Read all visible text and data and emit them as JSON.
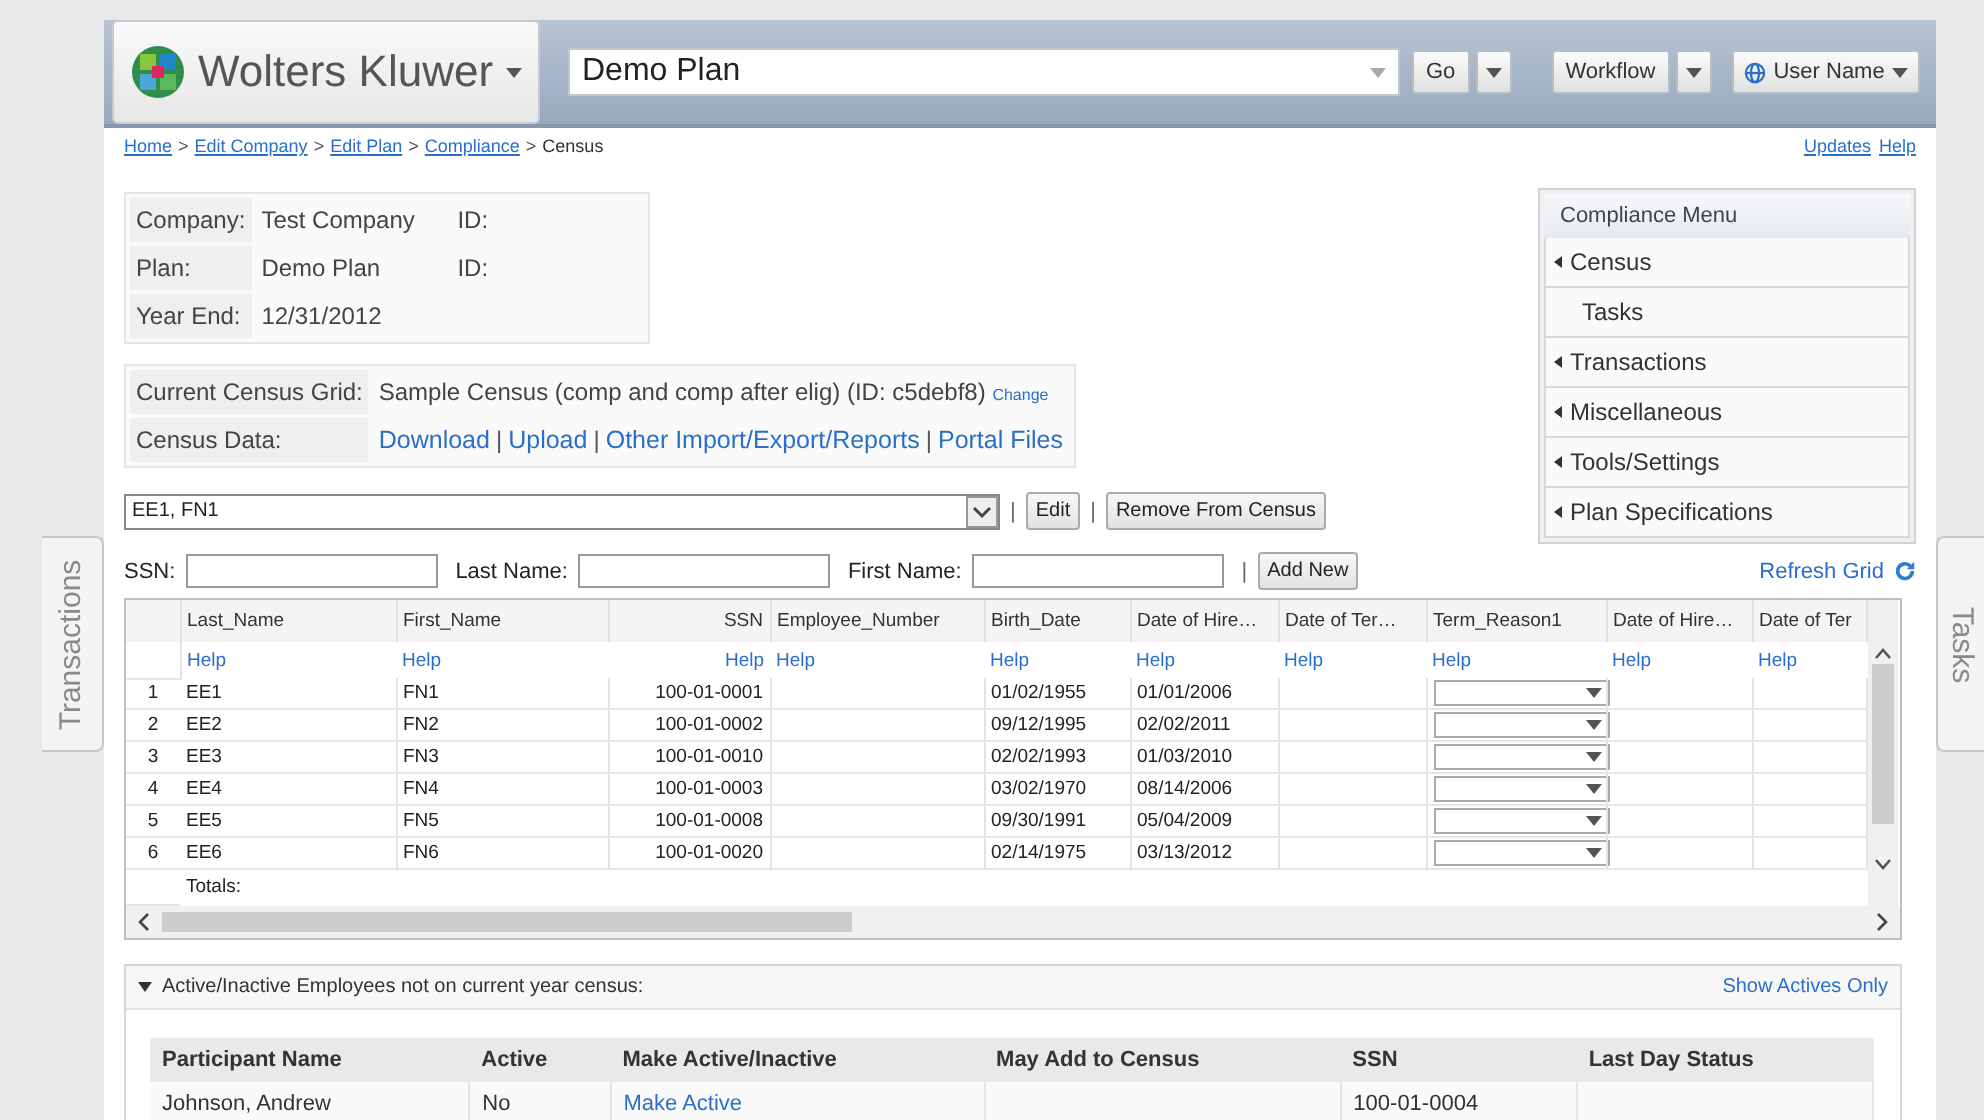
{
  "header": {
    "brand": "Wolters Kluwer",
    "search_value": "Demo Plan",
    "go": "Go",
    "workflow": "Workflow",
    "user": "User Name"
  },
  "breadcrumb": {
    "links": [
      "Home",
      "Edit Company",
      "Edit Plan",
      "Compliance"
    ],
    "separator": ">",
    "current": "Census",
    "right_links": [
      "Updates",
      "Help"
    ]
  },
  "info": [
    {
      "label": "Company:",
      "value": "Test Company",
      "id_label": "ID:"
    },
    {
      "label": "Plan:",
      "value": "Demo Plan",
      "id_label": "ID:"
    },
    {
      "label": "Year End:",
      "value": "12/31/2012"
    }
  ],
  "census": {
    "grid_label": "Current Census Grid:",
    "grid_value": "Sample Census (comp and comp after elig) (ID: c5debf8)",
    "change": "Change",
    "data_label": "Census Data:",
    "separator": "|",
    "data_links": [
      "Download",
      "Upload",
      "Other Import/Export/Reports",
      "Portal Files"
    ]
  },
  "compliance_menu": {
    "title": "Compliance Menu",
    "items": [
      {
        "label": "Census",
        "collapsible": true
      },
      {
        "label": "Tasks",
        "collapsible": false
      },
      {
        "label": "Transactions",
        "collapsible": true
      },
      {
        "label": "Miscellaneous",
        "collapsible": true
      },
      {
        "label": "Tools/Settings",
        "collapsible": true
      },
      {
        "label": "Plan Specifications",
        "collapsible": true
      }
    ]
  },
  "employee_select": {
    "value": "EE1, FN1",
    "separator": "|",
    "edit": "Edit",
    "remove": "Remove From Census"
  },
  "filters": {
    "fields": [
      "SSN:",
      "Last Name:",
      "First Name:"
    ],
    "separator": "|",
    "add_new": "Add New",
    "refresh": "Refresh Grid"
  },
  "grid": {
    "columns": [
      {
        "label": "Last_Name",
        "kind": "text",
        "help": "Help"
      },
      {
        "label": "First_Name",
        "kind": "text",
        "help": "Help"
      },
      {
        "label": "SSN",
        "kind": "number",
        "help": "Help"
      },
      {
        "label": "Employee_Number",
        "kind": "text",
        "help": "Help"
      },
      {
        "label": "Birth_Date",
        "kind": "text",
        "help": "Help"
      },
      {
        "label": "Date of Hire…",
        "kind": "text",
        "help": "Help"
      },
      {
        "label": "Date of Ter…",
        "kind": "text",
        "help": "Help"
      },
      {
        "label": "Term_Reason1",
        "kind": "select",
        "help": "Help"
      },
      {
        "label": "Date of Hire…",
        "kind": "text",
        "help": "Help"
      },
      {
        "label": "Date of Ter",
        "kind": "text",
        "help": "Help"
      }
    ],
    "rows": [
      {
        "num": "1",
        "cells": [
          "EE1",
          "FN1",
          "100-01-0001",
          "",
          "01/02/1955",
          "01/01/2006",
          "",
          "",
          "",
          ""
        ]
      },
      {
        "num": "2",
        "cells": [
          "EE2",
          "FN2",
          "100-01-0002",
          "",
          "09/12/1995",
          "02/02/2011",
          "",
          "",
          "",
          ""
        ]
      },
      {
        "num": "3",
        "cells": [
          "EE3",
          "FN3",
          "100-01-0010",
          "",
          "02/02/1993",
          "01/03/2010",
          "",
          "",
          "",
          ""
        ]
      },
      {
        "num": "4",
        "cells": [
          "EE4",
          "FN4",
          "100-01-0003",
          "",
          "03/02/1970",
          "08/14/2006",
          "",
          "",
          "",
          ""
        ]
      },
      {
        "num": "5",
        "cells": [
          "EE5",
          "FN5",
          "100-01-0008",
          "",
          "09/30/1991",
          "05/04/2009",
          "",
          "",
          "",
          ""
        ]
      },
      {
        "num": "6",
        "cells": [
          "EE6",
          "FN6",
          "100-01-0020",
          "",
          "02/14/1975",
          "03/13/2012",
          "",
          "",
          "",
          ""
        ]
      }
    ],
    "totals": "Totals:"
  },
  "inactive_panel": {
    "title": "Active/Inactive Employees not on current year census:",
    "expanded": true,
    "show_link": "Show Actives Only",
    "columns": [
      "Participant Name",
      "Active",
      "Make Active/Inactive",
      "May Add to Census",
      "SSN",
      "Last Day Status"
    ],
    "rows": [
      {
        "name": "Johnson, Andrew",
        "active": "No",
        "action": "Make Active",
        "may_add": "",
        "ssn": "100-01-0004",
        "status": ""
      }
    ]
  },
  "side_tabs": {
    "left": "Transactions",
    "right": "Tasks"
  }
}
